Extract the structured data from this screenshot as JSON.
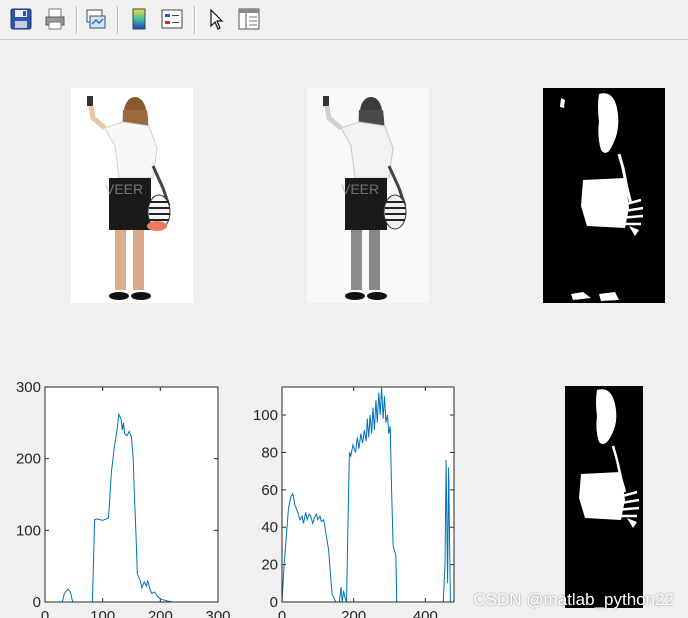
{
  "toolbar": {
    "buttons": [
      {
        "name": "save-icon"
      },
      {
        "name": "print-icon"
      },
      {
        "name": "link-plot-icon"
      },
      {
        "name": "insert-colorbar-icon"
      },
      {
        "name": "insert-legend-icon"
      },
      {
        "name": "edit-plot-pointer-icon"
      },
      {
        "name": "show-plot-tools-icon"
      }
    ]
  },
  "watermark": "CSDN @matlab_python22",
  "chart_data": [
    {
      "type": "line",
      "xlim": [
        0,
        300
      ],
      "ylim": [
        0,
        300
      ],
      "xticks": [
        "0",
        "100",
        "200",
        "300"
      ],
      "yticks": [
        "0",
        "100",
        "200",
        "300"
      ],
      "x": [
        0,
        30,
        33,
        36,
        40,
        44,
        48,
        60,
        75,
        82,
        84,
        86,
        90,
        100,
        110,
        112,
        115,
        118,
        120,
        125,
        128,
        132,
        134,
        136,
        138,
        142,
        146,
        150,
        153,
        155,
        158,
        160,
        165,
        168,
        172,
        176,
        178,
        182,
        185,
        190,
        195,
        200,
        210,
        215,
        220,
        300
      ],
      "y": [
        0,
        0,
        10,
        15,
        18,
        14,
        0,
        0,
        0,
        0,
        50,
        115,
        116,
        114,
        117,
        140,
        180,
        200,
        215,
        240,
        262,
        255,
        240,
        250,
        235,
        232,
        238,
        230,
        200,
        150,
        90,
        40,
        30,
        20,
        28,
        22,
        30,
        18,
        12,
        14,
        8,
        4,
        2,
        1,
        0,
        0
      ]
    },
    {
      "type": "line",
      "xlim": [
        0,
        480
      ],
      "ylim": [
        0,
        115
      ],
      "xticks": [
        "0",
        "200",
        "400"
      ],
      "yticks": [
        "0",
        "20",
        "40",
        "60",
        "80",
        "100"
      ],
      "x": [
        0,
        3,
        6,
        10,
        14,
        18,
        24,
        30,
        36,
        40,
        44,
        50,
        56,
        60,
        66,
        70,
        76,
        80,
        86,
        90,
        96,
        100,
        106,
        110,
        116,
        120,
        124,
        130,
        135,
        140,
        150,
        160,
        165,
        168,
        172,
        176,
        180,
        184,
        188,
        192,
        198,
        205,
        210,
        215,
        220,
        225,
        230,
        235,
        238,
        242,
        246,
        250,
        254,
        258,
        262,
        266,
        270,
        274,
        278,
        282,
        286,
        290,
        294,
        298,
        302,
        306,
        310,
        318,
        320,
        330,
        400,
        450,
        455,
        458,
        462,
        465,
        470,
        475
      ],
      "y": [
        0,
        10,
        20,
        30,
        40,
        50,
        56,
        58,
        52,
        50,
        48,
        44,
        46,
        42,
        48,
        44,
        47,
        46,
        42,
        45,
        47,
        44,
        46,
        43,
        44,
        40,
        35,
        28,
        15,
        4,
        0,
        0,
        8,
        0,
        6,
        2,
        0,
        40,
        80,
        78,
        84,
        80,
        88,
        82,
        90,
        85,
        92,
        86,
        98,
        88,
        100,
        90,
        104,
        92,
        108,
        96,
        112,
        100,
        115,
        98,
        110,
        96,
        100,
        90,
        94,
        60,
        30,
        25,
        0,
        0,
        0,
        0,
        20,
        76,
        10,
        72,
        0,
        0
      ]
    }
  ]
}
